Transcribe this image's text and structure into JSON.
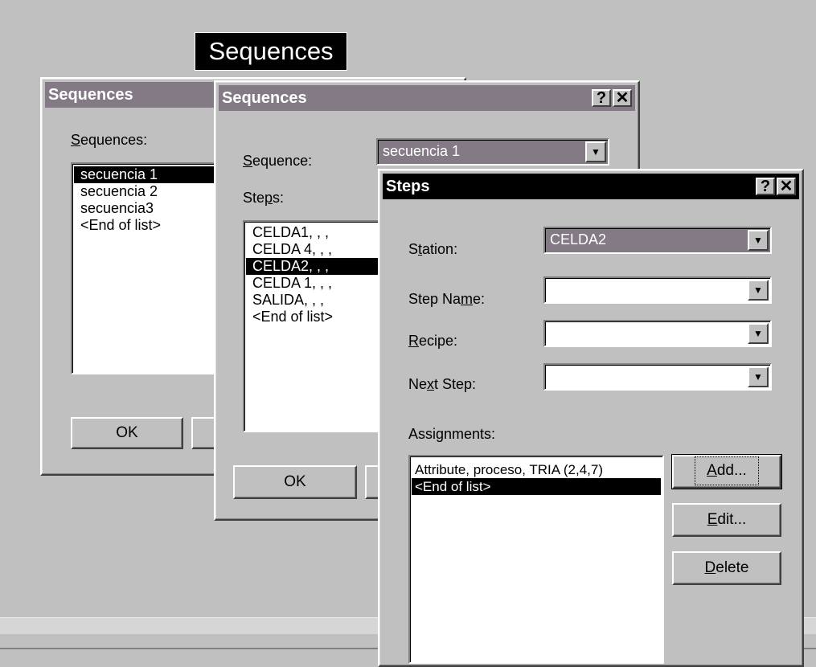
{
  "caption": "Sequences",
  "dialog1": {
    "title": "Sequences",
    "list_label_pre": "",
    "list_label_u": "S",
    "list_label_post": "equences:",
    "items": [
      "secuencia 1",
      "secuencia 2",
      "secuencia3",
      "<End of list>"
    ],
    "ok_label": "OK"
  },
  "dialog2": {
    "title": "Sequences",
    "help_btn": "?",
    "close_btn": "✕",
    "sequence_label_u": "S",
    "sequence_label_post": "equence:",
    "sequence_value": "secuencia 1",
    "steps_label_pre": "Ste",
    "steps_label_u": "p",
    "steps_label_post": "s:",
    "steps": [
      "CELDA1, , ,",
      "CELDA 4, , ,",
      "CELDA2, , ,",
      "CELDA 1, , ,",
      "SALIDA, , ,",
      "<End of list>"
    ],
    "ok_label": "OK"
  },
  "dialog3": {
    "title": "Steps",
    "help_btn": "?",
    "close_btn": "✕",
    "station_pre": "S",
    "station_u": "t",
    "station_post": "ation:",
    "station_value": "CELDA2",
    "stepname_pre": "Step Na",
    "stepname_u": "m",
    "stepname_post": "e:",
    "stepname_value": "",
    "recipe_u": "R",
    "recipe_post": "ecipe:",
    "recipe_value": "",
    "nextstep_pre": "Ne",
    "nextstep_u": "x",
    "nextstep_post": "t Step:",
    "nextstep_value": "",
    "assign_pre": "Assi",
    "assign_u": "g",
    "assign_post": "nments:",
    "assignments": [
      "Attribute, proceso, TRIA (2,4,7)",
      "<End of list>"
    ],
    "add_u": "A",
    "add_post": "dd...",
    "edit_u": "E",
    "edit_post": "dit...",
    "delete_u": "D",
    "delete_post": "elete"
  }
}
